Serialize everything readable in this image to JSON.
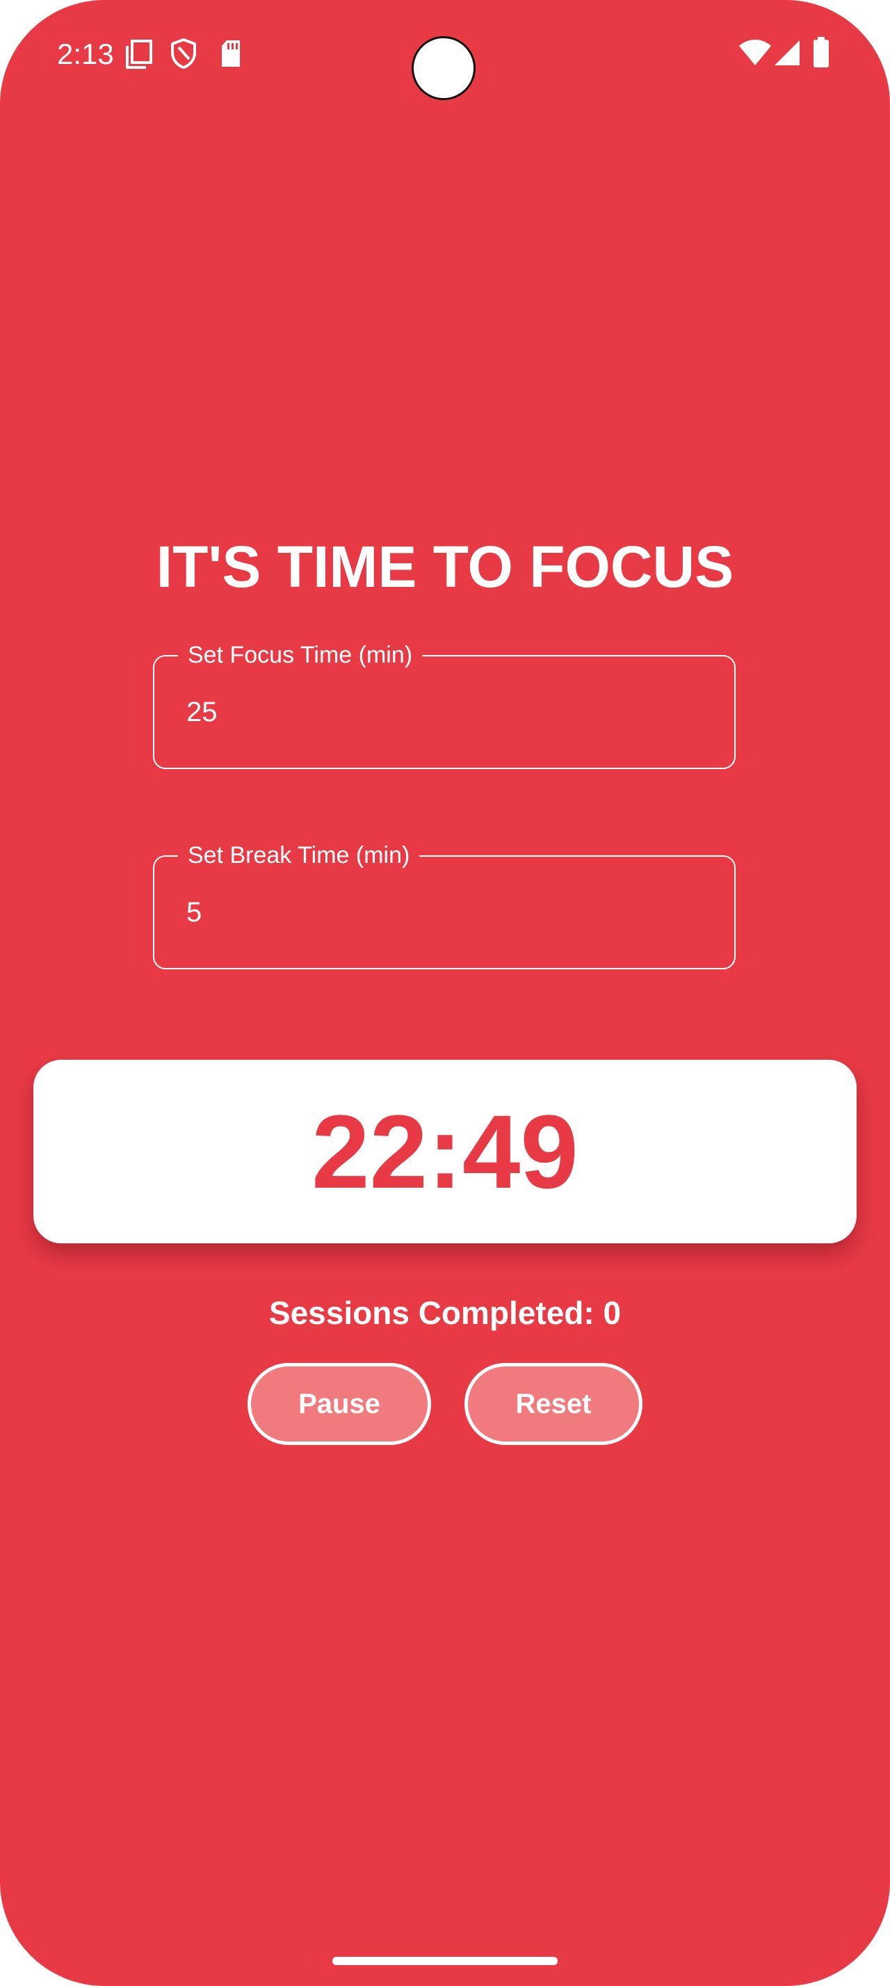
{
  "status_bar": {
    "time": "2:13",
    "left_icons": [
      "screen-share-icon",
      "shield-icon",
      "sd-card-icon"
    ],
    "right_icons": [
      "wifi-icon",
      "cellular-signal-icon",
      "battery-icon"
    ]
  },
  "theme": {
    "background": "#E83A45",
    "card": "#FFFFFF",
    "button_fill": "#F07A7D",
    "text": "#FFFFFF"
  },
  "main": {
    "title": "IT'S TIME TO FOCUS",
    "focus_field": {
      "label": "Set Focus Time (min)",
      "value": "25"
    },
    "break_field": {
      "label": "Set Break Time (min)",
      "value": "5"
    },
    "timer": "22:49",
    "sessions_text": "Sessions Completed: 0",
    "pause_label": "Pause",
    "reset_label": "Reset"
  }
}
